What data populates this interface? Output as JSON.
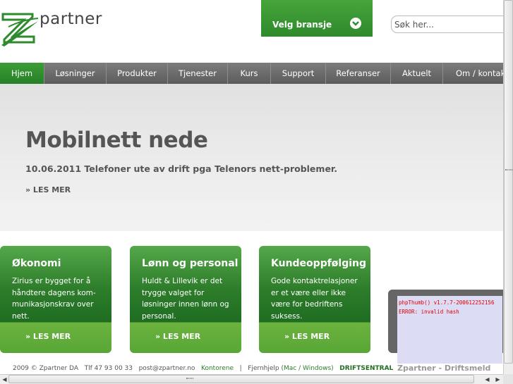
{
  "header": {
    "logo_text": "partner",
    "bransje_label": "Velg bransje",
    "search_placeholder": "Søk her..."
  },
  "nav": {
    "items": [
      {
        "label": "Hjem",
        "active": true
      },
      {
        "label": "Løsninger"
      },
      {
        "label": "Produkter"
      },
      {
        "label": "Tjenester"
      },
      {
        "label": "Kurs"
      },
      {
        "label": "Support"
      },
      {
        "label": "Referanser"
      },
      {
        "label": "Aktuelt"
      },
      {
        "label": "Om / kontakt"
      }
    ]
  },
  "hero": {
    "title": "Mobilnett nede",
    "subtitle": "10.06.2011 Telefoner ute av drift pga Telenors nett-problemer.",
    "more": "» LES MER"
  },
  "cards": [
    {
      "title": "Økonomi",
      "text": "Zirius er bygget for å håndtere dagens kom-munikasjonskrav over nett.",
      "more": "» LES MER"
    },
    {
      "title": "Lønn og personal",
      "text": "Huldt & Lillevik er det trygge valget for løsninger innen lønn og personal.",
      "more": "» LES MER"
    },
    {
      "title": "Kundeoppfølging",
      "text": "Gode kontaktrelasjoner er et være eller ikke være for bedriftens suksess.",
      "more": "» LES MER"
    }
  ],
  "popup": {
    "line1": "phpThumb() v1.7.7-200612252156",
    "line2": "ERROR: invalid hash",
    "caption": "Zpartner - Driftsmeld"
  },
  "footer": {
    "copyright": "2009 © Zpartner DA",
    "phone": "Tlf 47 93 00 33",
    "email": "post@zpartner.no",
    "kontorene": "Kontorene",
    "separator": "|",
    "fjernhjelp": "Fjernhjelp",
    "mac_windows": "(Mac / Windows)",
    "driftsentral": "DRIFTSENTRAL"
  },
  "colors": {
    "brand_green": "#2e8a2c",
    "nav_gray": "#6b6b6b",
    "hero_bg": "#e8e8e8"
  },
  "icons": {
    "bransje": "chevron-down-circle-icon",
    "logo": "z-logo-icon"
  }
}
